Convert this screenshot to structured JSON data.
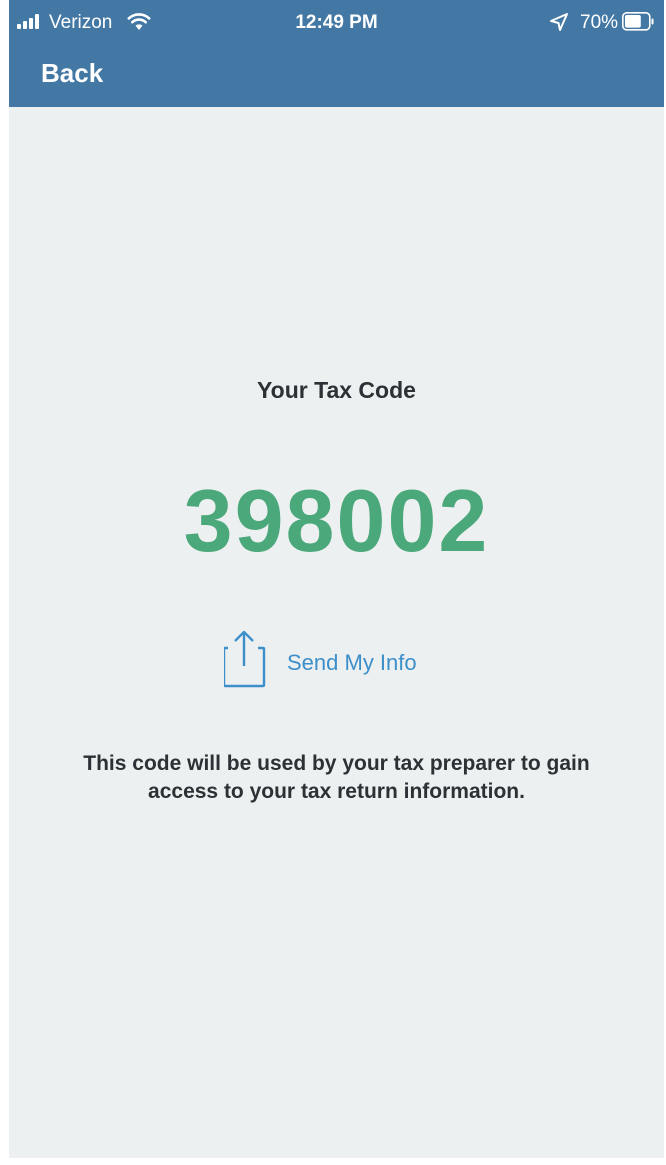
{
  "status_bar": {
    "carrier": "Verizon",
    "time": "12:49 PM",
    "battery": "70%",
    "battery_level": 0.7
  },
  "nav": {
    "back_label": "Back"
  },
  "main": {
    "title": "Your Tax Code",
    "code": "398002",
    "send_label": "Send My Info",
    "description": "This code will be used by your tax preparer to gain access to your tax return information."
  },
  "colors": {
    "header": "#4478a4",
    "background": "#edf0f1",
    "code": "#4aa87b",
    "link": "#3d8fc9",
    "text": "#2d3035"
  },
  "icons": {
    "share": "share-icon",
    "wifi": "wifi-icon",
    "location": "location-arrow-icon",
    "battery": "battery-icon",
    "signal": "signal-strength-icon"
  }
}
